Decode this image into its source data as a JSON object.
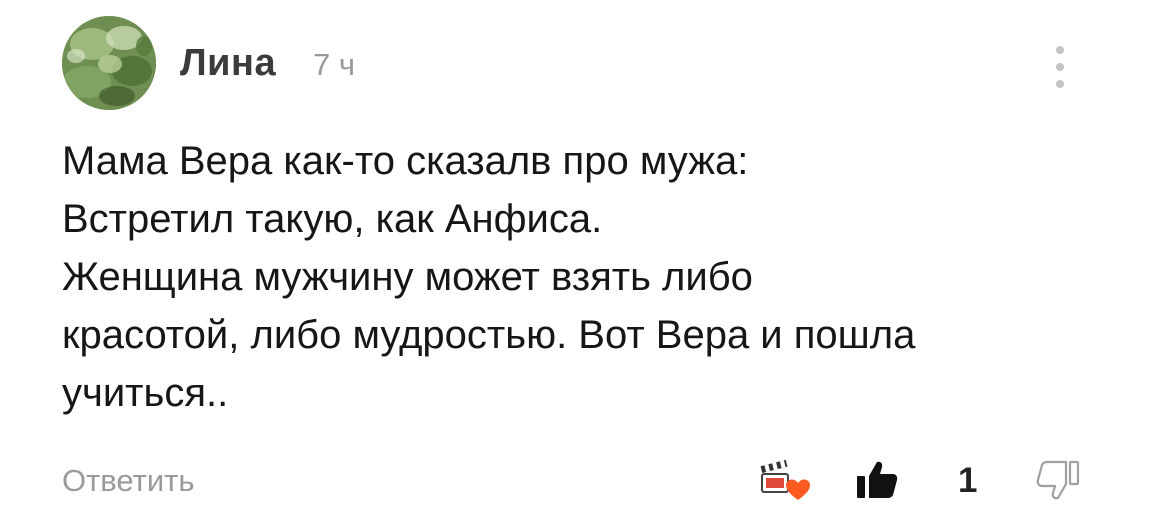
{
  "comment": {
    "author": "Лина",
    "time": "7 ч",
    "text_lines": [
      "Мама Вера как-то сказалв про мужа:",
      "Встретил такую, как Анфиса.",
      "Женщина мужчину может взять либо",
      "красотой, либо мудростью. Вот Вера и пошла",
      "учиться.."
    ],
    "reply_label": "Ответить",
    "like_count": "1"
  },
  "icons": {
    "avatar": "avatar-photo",
    "menu": "more-vertical-icon",
    "reactions": "reactions-clapperboard-heart-icon",
    "like": "thumbs-up-icon",
    "dislike": "thumbs-down-icon"
  },
  "colors": {
    "text": "#161616",
    "muted": "#9a9a9a",
    "author": "#3b3b3b",
    "heart": "#ff5a1f",
    "like_icon": "#111111",
    "dislike_icon": "#a0a0a0"
  }
}
